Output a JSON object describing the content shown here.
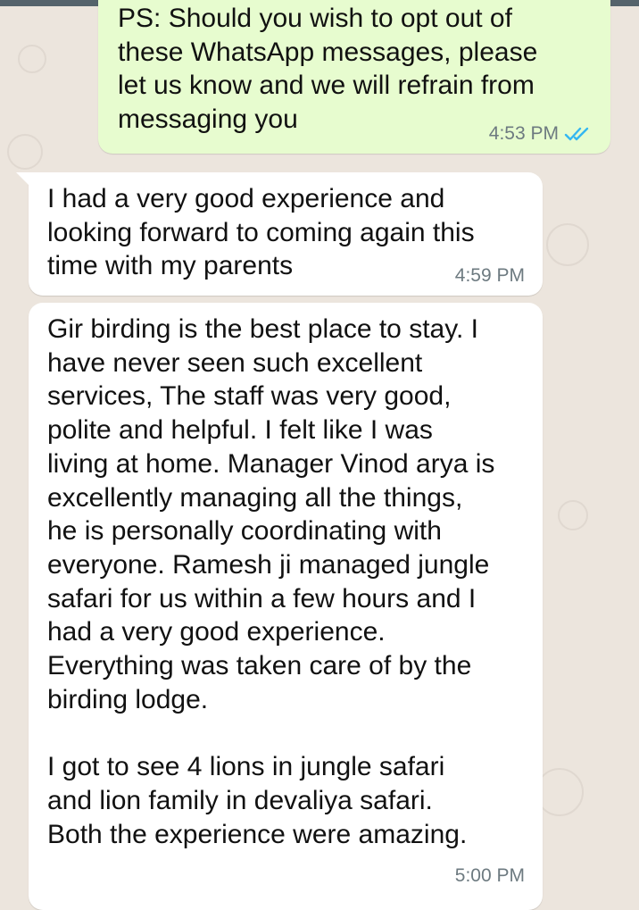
{
  "chat": {
    "messages": [
      {
        "direction": "outgoing",
        "text": "PS: Should you wish to opt out of\nthese WhatsApp messages, please\nlet us know and we will refrain from\nmessaging you",
        "time": "4:53 PM",
        "status_icon": "double-check-read-icon",
        "status_color": "#34b7f1"
      },
      {
        "direction": "incoming",
        "text": "I had a very good experience and\nlooking forward to coming again this\ntime with my parents",
        "time": "4:59 PM"
      },
      {
        "direction": "incoming",
        "text": "Gir birding is the best place to stay. I\nhave never seen such excellent\nservices, The staff was very good,\npolite and helpful. I felt like I was\nliving at home. Manager Vinod arya is\nexcellently managing all the things,\nhe is personally coordinating with\neveryone. Ramesh ji managed jungle\nsafari for us within a few hours and I\nhad a very good experience.\nEverything was taken care of by the\nbirding lodge.\n\nI got to see 4 lions in jungle safari\nand lion family in devaliya safari.\nBoth the experience were amazing.",
        "time": "5:00 PM"
      }
    ]
  },
  "colors": {
    "wallpaper": "#ece5dd",
    "outgoing_bubble": "#e7fccf",
    "incoming_bubble": "#ffffff",
    "read_ticks": "#34b7f1"
  }
}
